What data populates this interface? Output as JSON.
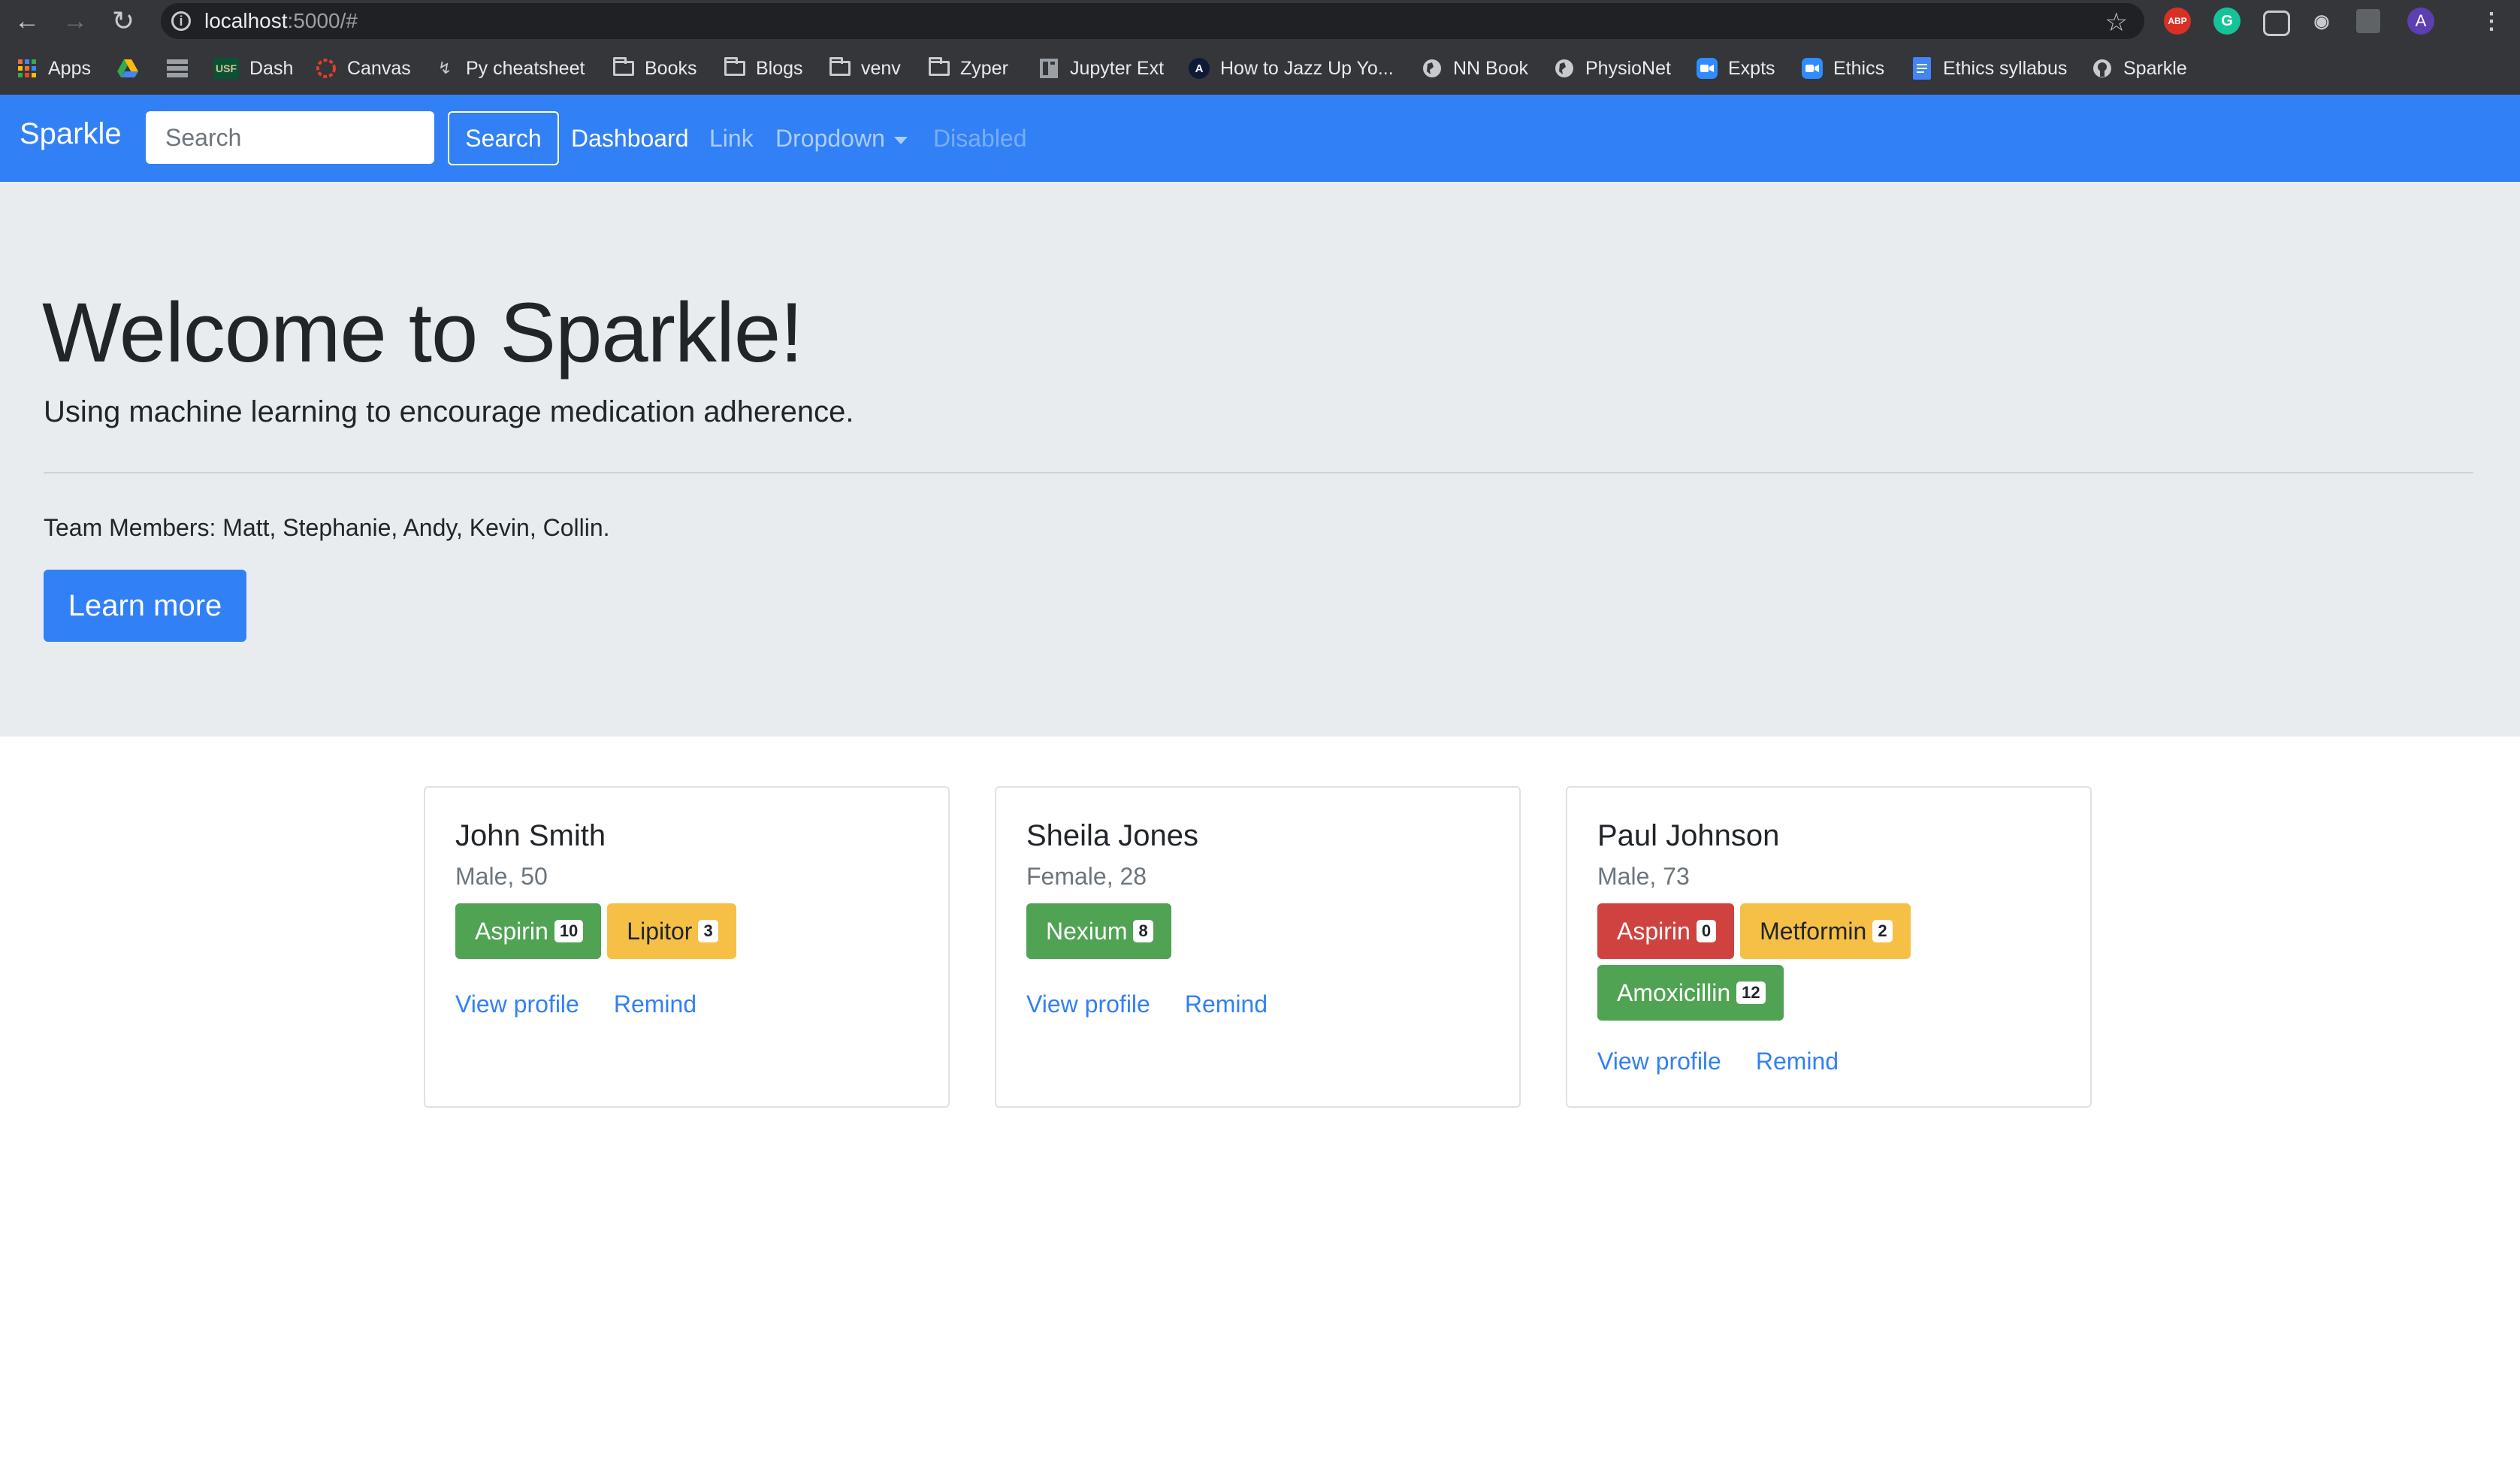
{
  "browser": {
    "url_host": "localhost",
    "url_rest": ":5000/#",
    "profile_initial": "A",
    "bookmarks": [
      {
        "label": "Apps",
        "icon": "apps-grid-icon"
      },
      {
        "label": "",
        "icon": "google-drive-icon"
      },
      {
        "label": "",
        "icon": "sheets-grid-icon"
      },
      {
        "label": "Dash",
        "icon": "usf-logo-icon"
      },
      {
        "label": "Canvas",
        "icon": "canvas-icon"
      },
      {
        "label": "Py cheatsheet",
        "icon": "bolt-icon"
      },
      {
        "label": "Books",
        "icon": "folder-icon"
      },
      {
        "label": "Blogs",
        "icon": "folder-icon"
      },
      {
        "label": "venv",
        "icon": "folder-icon"
      },
      {
        "label": "Zyper",
        "icon": "folder-icon"
      },
      {
        "label": "Jupyter Ext",
        "icon": "page-icon"
      },
      {
        "label": "How to Jazz Up Yo...",
        "icon": "angular-icon"
      },
      {
        "label": "NN Book",
        "icon": "globe-icon"
      },
      {
        "label": "PhysioNet",
        "icon": "globe-icon"
      },
      {
        "label": "Expts",
        "icon": "zoom-icon"
      },
      {
        "label": "Ethics",
        "icon": "zoom-icon"
      },
      {
        "label": "Ethics syllabus",
        "icon": "docs-icon"
      },
      {
        "label": "Sparkle",
        "icon": "github-icon"
      }
    ],
    "extensions": [
      "ABP",
      "G",
      "",
      "",
      "",
      ""
    ]
  },
  "navbar": {
    "brand": "Sparkle",
    "search_placeholder": "Search",
    "search_button": "Search",
    "links": {
      "dashboard": "Dashboard",
      "link": "Link",
      "dropdown": "Dropdown",
      "disabled": "Disabled"
    }
  },
  "jumbotron": {
    "title": "Welcome to Sparkle!",
    "lead": "Using machine learning to encourage medication adherence.",
    "team": "Team Members: Matt, Stephanie, Andy, Kevin, Collin.",
    "button": "Learn more"
  },
  "patients": [
    {
      "name": "John Smith",
      "info": "Male, 50",
      "meds": [
        {
          "name": "Aspirin",
          "count": "10",
          "status": "green"
        },
        {
          "name": "Lipitor",
          "count": "3",
          "status": "yellow"
        }
      ],
      "view_label": "View profile",
      "remind_label": "Remind"
    },
    {
      "name": "Sheila Jones",
      "info": "Female, 28",
      "meds": [
        {
          "name": "Nexium",
          "count": "8",
          "status": "green"
        }
      ],
      "view_label": "View profile",
      "remind_label": "Remind"
    },
    {
      "name": "Paul Johnson",
      "info": "Male, 73",
      "meds": [
        {
          "name": "Aspirin",
          "count": "0",
          "status": "red"
        },
        {
          "name": "Metformin",
          "count": "2",
          "status": "yellow"
        },
        {
          "name": "Amoxicillin",
          "count": "12",
          "status": "green"
        }
      ],
      "view_label": "View profile",
      "remind_label": "Remind"
    }
  ],
  "colors": {
    "primary": "#3280f5",
    "jumbotron_bg": "#e9ecef",
    "success": "#4fa353",
    "danger": "#cf4240",
    "warning": "#f6c046"
  }
}
